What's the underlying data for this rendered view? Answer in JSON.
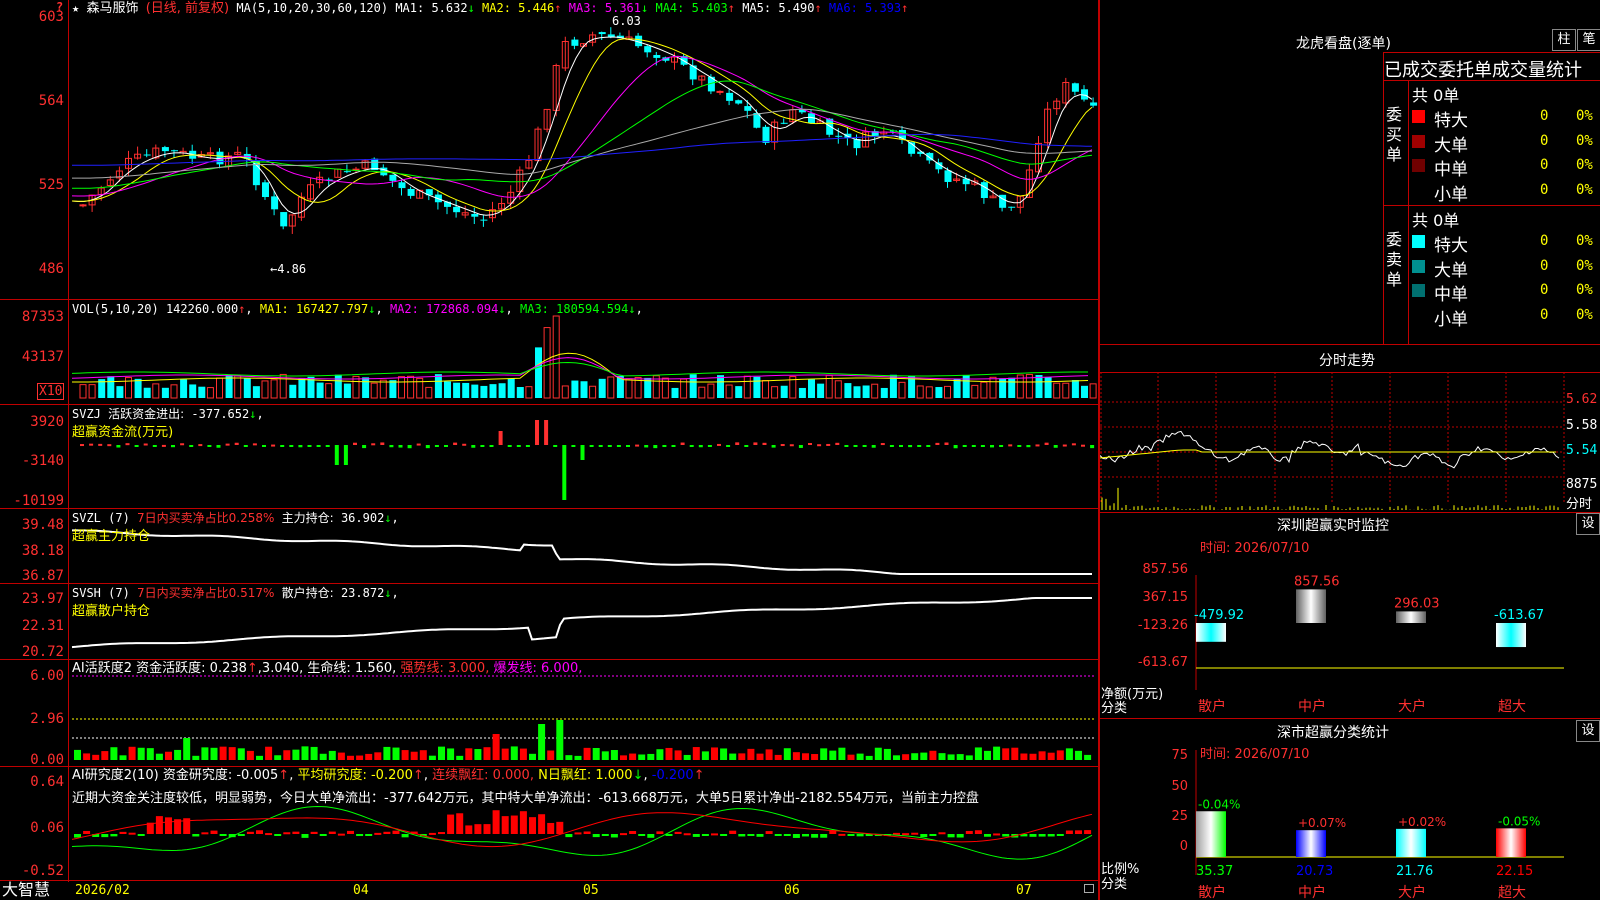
{
  "header": {
    "star": "★",
    "stock_name": "森马服饰",
    "period": "(日线, 前复权)",
    "ma_label": "MA(5,10,20,30,60,120)",
    "ma": [
      {
        "name": "MA1:",
        "value": "5.632",
        "arrow": "↓",
        "color": "#ffffff"
      },
      {
        "name": "MA2:",
        "value": "5.446",
        "arrow": "↑",
        "color": "#ffff00"
      },
      {
        "name": "MA3:",
        "value": "5.361",
        "arrow": "↓",
        "color": "#ff00ff"
      },
      {
        "name": "MA4:",
        "value": "5.403",
        "arrow": "↑",
        "color": "#00ff00"
      },
      {
        "name": "MA5:",
        "value": "5.490",
        "arrow": "↑",
        "color": "#ffffff"
      },
      {
        "name": "MA6:",
        "value": "5.393",
        "arrow": "↑",
        "color": "#0000ff"
      }
    ]
  },
  "price_axis": [
    "603",
    "564",
    "525",
    "486"
  ],
  "price_annotations": {
    "high": "6.03",
    "low": "4.86"
  },
  "vol": {
    "label": "VOL(5,10,20)",
    "value": "142260.000",
    "arrow": "↑",
    "ma": [
      {
        "name": "MA1:",
        "value": "167427.797",
        "arrow": "↓",
        "color": "#ffff00"
      },
      {
        "name": "MA2:",
        "value": "172868.094",
        "arrow": "↓",
        "color": "#ff00ff"
      },
      {
        "name": "MA3:",
        "value": "180594.594",
        "arrow": "↓",
        "color": "#00ff00"
      }
    ],
    "axis": [
      "87353",
      "43137"
    ],
    "unit": "X10"
  },
  "svzj": {
    "label": "SVZJ",
    "title": "活跃资金进出:",
    "value": "-377.652",
    "arrow": "↓",
    "sub": "超赢资金流(万元)",
    "axis": [
      "3920",
      "-3140",
      "-10199"
    ]
  },
  "svzl": {
    "label": "SVZL (7)",
    "title": "7日内买卖净占比0.258%",
    "hold": "主力持仓:",
    "value": "36.902",
    "arrow": "↓",
    "sub": "超赢主力持仓",
    "axis": [
      "39.48",
      "38.18",
      "36.87"
    ]
  },
  "svsh": {
    "label": "SVSH (7)",
    "title": "7日内买卖净占比0.517%",
    "hold": "散户持仓:",
    "value": "23.872",
    "arrow": "↓",
    "sub": "超赢散户持仓",
    "axis": [
      "23.97",
      "22.31",
      "20.72"
    ]
  },
  "ai1": {
    "label": "AI活跃度2",
    "t1": "资金活跃度:",
    "v1": "0.238",
    "a1": "↑",
    "v2": ",3.040,",
    "t3": "生命线:",
    "v3": "1.560,",
    "t4": "强势线:",
    "v4": "3.000,",
    "t5": "爆发线:",
    "v5": "6.000,",
    "axis": [
      "6.00",
      "2.96",
      "0.00"
    ]
  },
  "ai2": {
    "label": "AI研究度2(10)",
    "t1": "资金研究度:",
    "v1": "-0.005",
    "a1": "↑",
    "t2": "平均研究度:",
    "v2": "-0.200",
    "a2": "↑",
    "t3": "连续飘红:",
    "v3": "0.000,",
    "t4": "N日飘红:",
    "v4": "1.000",
    "a4": "↓",
    "v5": "-0.200",
    "a5": "↑",
    "axis": [
      "0.64",
      "0.06",
      "-0.52"
    ],
    "comment": "近期大资金关注度较低，明显弱势，今日大单净流出：-377.642万元，其中特大单净流出：-613.668万元，大单5日累计净出-2182.554万元，当前主力控盘"
  },
  "bottom": {
    "brand": "大智慧",
    "dates": [
      "2026/02",
      "04",
      "05",
      "06",
      "07"
    ]
  },
  "longhu": {
    "title": "龙虎看盘(逐单)",
    "btn_a": "柱",
    "btn_b": "笔",
    "subtitle": "已成交委托单成交量统计",
    "buy": {
      "label": "委买单",
      "total": "共 0单",
      "rows": [
        {
          "name": "特大",
          "v": "0",
          "p": "0%",
          "color": "#ff0000"
        },
        {
          "name": "大单",
          "v": "0",
          "p": "0%",
          "color": "#a00000"
        },
        {
          "name": "中单",
          "v": "0",
          "p": "0%",
          "color": "#700000"
        },
        {
          "name": "小单",
          "v": "0",
          "p": "0%",
          "color": ""
        }
      ]
    },
    "sell": {
      "label": "委卖单",
      "total": "共 0单",
      "rows": [
        {
          "name": "特大",
          "v": "0",
          "p": "0%",
          "color": "#00ffff"
        },
        {
          "name": "大单",
          "v": "0",
          "p": "0%",
          "color": "#009090"
        },
        {
          "name": "中单",
          "v": "0",
          "p": "0%",
          "color": "#007070"
        },
        {
          "name": "小单",
          "v": "0",
          "p": "0%",
          "color": ""
        }
      ]
    }
  },
  "intraday": {
    "title": "分时走势",
    "axis": [
      "5.62",
      "5.58",
      "5.54"
    ],
    "vol_value": "8875",
    "vol_label": "分时"
  },
  "monitor": {
    "title": "深圳超赢实时监控",
    "btn": "设",
    "time": "时间: 2026/07/10",
    "axis": [
      "857.56",
      "367.15",
      "-123.26",
      "-613.67"
    ],
    "ylabel": "净额(万元)",
    "xlabel": "分类",
    "categories": [
      "散户",
      "中户",
      "大户",
      "超大"
    ],
    "values": [
      "-479.92",
      "857.56",
      "296.03",
      "-613.67"
    ]
  },
  "stats": {
    "title": "深市超赢分类统计",
    "btn": "设",
    "time": "时间: 2026/07/10",
    "axis": [
      "75",
      "50",
      "25",
      "0"
    ],
    "ylabel": "比例%",
    "xlabel": "分类",
    "categories": [
      "散户",
      "中户",
      "大户",
      "超大"
    ],
    "change": [
      "-0.04%",
      "+0.07%",
      "+0.02%",
      "-0.05%"
    ],
    "values": [
      "35.37",
      "20.73",
      "21.76",
      "22.15"
    ]
  },
  "chart_data": [
    {
      "type": "candlestick",
      "title": "森马服饰(日线, 前复权)",
      "y_ticks": [
        6.03,
        5.64,
        5.25,
        4.86
      ],
      "x_ticks": [
        "2026/02",
        "04",
        "05",
        "06",
        "07"
      ],
      "high": 6.03,
      "low": 4.86
    },
    {
      "type": "bar",
      "title": "深圳超赢实时监控",
      "categories": [
        "散户",
        "中户",
        "大户",
        "超大"
      ],
      "values": [
        -479.92,
        857.56,
        296.03,
        -613.67
      ],
      "ylabel": "净额(万元)",
      "xlabel": "分类",
      "ylim": [
        -613.67,
        857.56
      ]
    },
    {
      "type": "bar",
      "title": "深市超赢分类统计",
      "categories": [
        "散户",
        "中户",
        "大户",
        "超大"
      ],
      "values": [
        35.37,
        20.73,
        21.76,
        22.15
      ],
      "ylabel": "比例%",
      "xlabel": "分类",
      "ylim": [
        0,
        75
      ]
    }
  ]
}
